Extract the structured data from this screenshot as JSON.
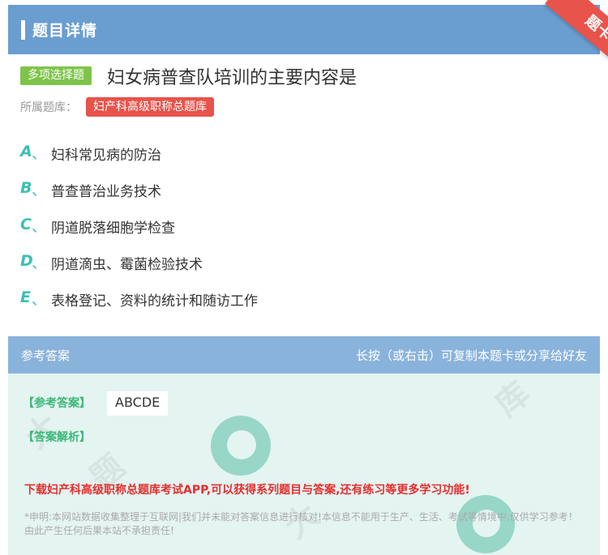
{
  "header": {
    "title": "题目详情"
  },
  "ribbon": {
    "label": "题卡"
  },
  "question": {
    "type_badge": "多项选择题",
    "text": "妇女病普查队培训的主要内容是",
    "bank_label": "所属题库：",
    "bank_name": "妇产科高级职称总题库"
  },
  "options": [
    {
      "letter": "A",
      "sep": "、",
      "text": "妇科常见病的防治"
    },
    {
      "letter": "B",
      "sep": "、",
      "text": "普查普治业务技术"
    },
    {
      "letter": "C",
      "sep": "、",
      "text": "阴道脱落细胞学检查"
    },
    {
      "letter": "D",
      "sep": "、",
      "text": "阴道滴虫、霉菌检验技术"
    },
    {
      "letter": "E",
      "sep": "、",
      "text": "表格登记、资料的统计和随访工作"
    }
  ],
  "answer_section": {
    "title": "参考答案",
    "hint": "长按（或右击）可复制本题卡或分享给好友",
    "answer_label": "【参考答案】",
    "answer_value": "ABCDE",
    "analysis_label": "【答案解析】",
    "promo": "下载妇产科高级职称总题库考试APP,可以获得系列题目与答案,还有练习等更多学习功能!",
    "disclaimer": "*申明:本网站数据收集整理于互联网|我们并未能对答案信息进行核对!本信息不能用于生产、生活、考试等情境中,仅供学习参考！由此产生任何后果本站不承担责任!"
  },
  "colors": {
    "header_bg": "#6a9ed1",
    "ribbon": "#e8534b",
    "type_badge": "#7ec44a",
    "bank_tag": "#e8534b",
    "option_letter": "#3cbfb4",
    "answer_label": "#3cb878",
    "promo": "#e52e2e"
  }
}
